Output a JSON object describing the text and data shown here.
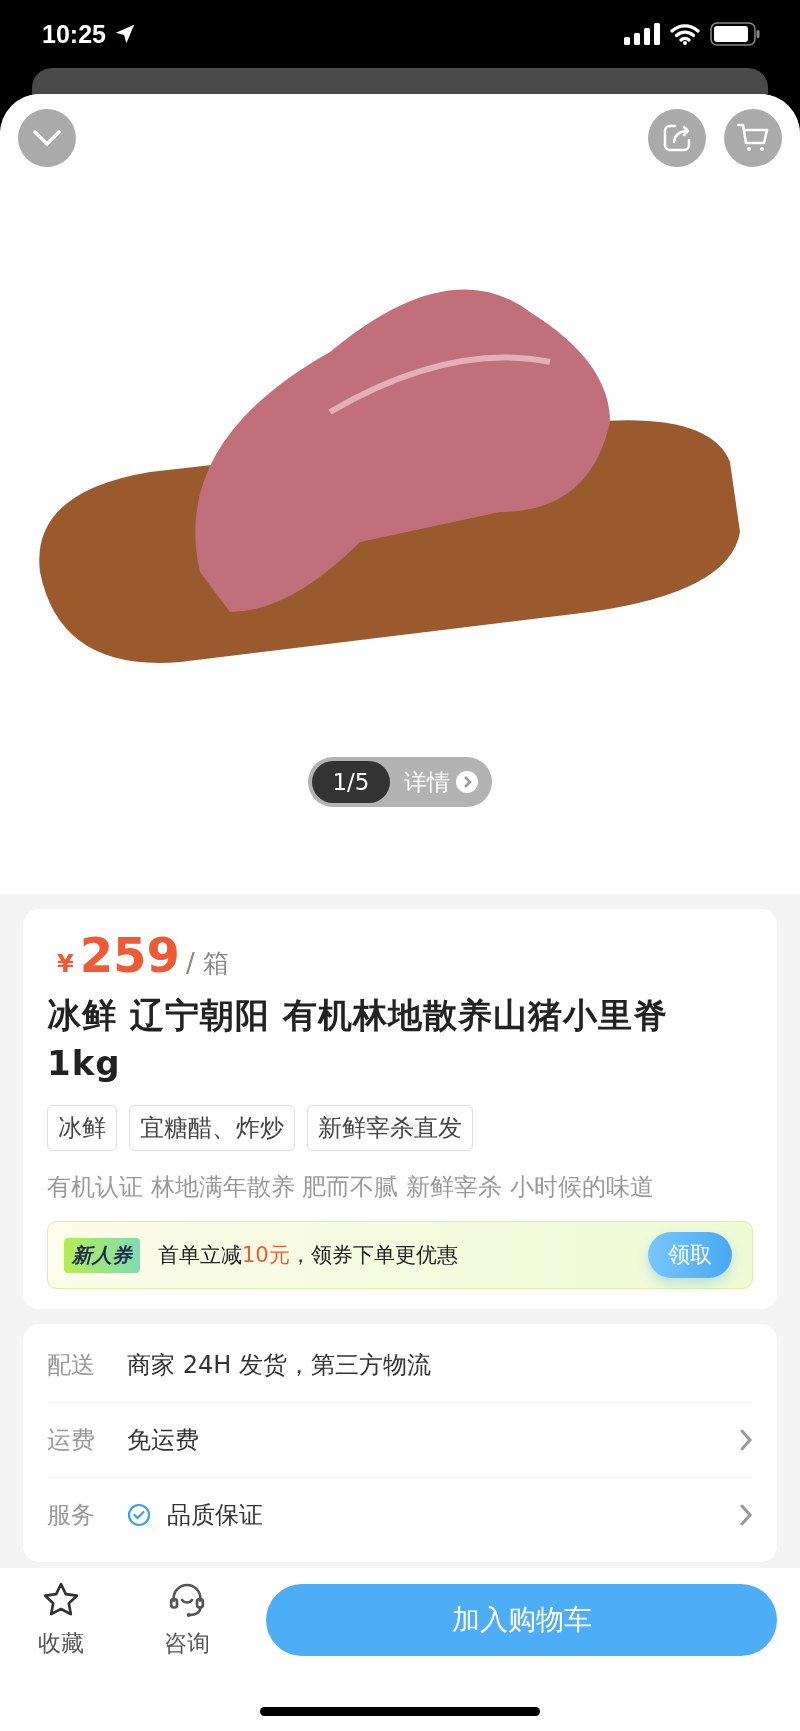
{
  "status_bar": {
    "time": "10:25"
  },
  "gallery": {
    "counter": "1/5",
    "details_label": "详情"
  },
  "price": {
    "currency": "¥",
    "amount": "259",
    "unit": "/ 箱"
  },
  "title": "冰鲜 辽宁朝阳 有机林地散养山猪小里脊1kg",
  "tags": [
    "冰鲜",
    "宜糖醋、炸炒",
    "新鲜宰杀直发"
  ],
  "subtitle": "有机认证 林地满年散养 肥而不腻 新鲜宰杀 小时候的味道",
  "coupon": {
    "badge": "新人券",
    "segments": [
      {
        "text": "首单立减",
        "highlight": false
      },
      {
        "text": "10元",
        "highlight": true
      },
      {
        "text": "，领券下单更优惠",
        "highlight": false
      }
    ],
    "button": "领取"
  },
  "info_rows": [
    {
      "label": "配送",
      "value": "商家 24H 发货，第三方物流",
      "verified": false,
      "arrow": false
    },
    {
      "label": "运费",
      "value": "免运费",
      "verified": false,
      "arrow": true
    },
    {
      "label": "服务",
      "value": "品质保证",
      "verified": true,
      "arrow": true
    }
  ],
  "bottom_bar": {
    "actions": [
      {
        "kind": "star",
        "label": "收藏"
      },
      {
        "kind": "support",
        "label": "咨询"
      }
    ],
    "primary_button": "加入购物车"
  }
}
